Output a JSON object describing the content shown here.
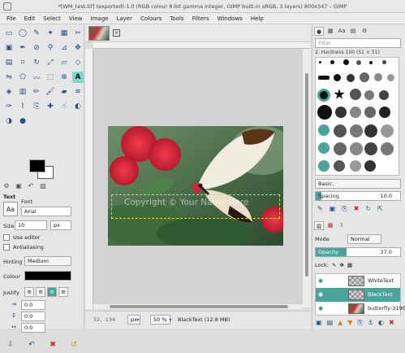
{
  "window": {
    "title": "*[WM_test.tif] (exported)-1.0 (RGB colour 8-bit gamma integer, GIMP built-in sRGB, 3 layers) 800x547 – GIMP"
  },
  "menu": [
    "File",
    "Edit",
    "Select",
    "View",
    "Image",
    "Layer",
    "Colours",
    "Tools",
    "Filters",
    "Windows",
    "Help"
  ],
  "tool_options": {
    "heading": "Text",
    "font_label": "Font",
    "font_value": "Arial",
    "size_label": "Size",
    "size_value": "10",
    "size_unit": "px",
    "use_editor": "Use editor",
    "antialiasing": "Antialiasing",
    "hinting_label": "Hinting",
    "hinting_value": "Medium",
    "colour_label": "Colour",
    "justify_label": "Justify",
    "indent_value": "0.0",
    "line_spacing_value": "0.0",
    "letter_spacing_value": "0.0"
  },
  "canvas": {
    "watermark_text": "Copyright © Your Name Here"
  },
  "status": {
    "coords": "52, -134",
    "unit": "px",
    "zoom": "50 %",
    "info": "BlackText (12.8 MB)"
  },
  "brushes": {
    "filter_placeholder": "Filter",
    "current_brush": "2. Hardness 100 (51 × 51)",
    "brush_set": "Basic,",
    "spacing_label": "Spacing",
    "spacing_value": "10.0"
  },
  "layers": {
    "mode_label": "Mode",
    "mode_value": "Normal",
    "opacity_label": "Opacity",
    "opacity_value": "37.0",
    "opacity_fraction": 0.37,
    "lock_label": "Lock:",
    "items": [
      {
        "name": "WhiteText",
        "selected": false
      },
      {
        "name": "BlackText",
        "selected": true
      },
      {
        "name": "butterfly-31903",
        "selected": false
      }
    ]
  },
  "colors": {
    "accent": "#4aa49b",
    "foreground": "#000000",
    "background": "#ffffff"
  }
}
